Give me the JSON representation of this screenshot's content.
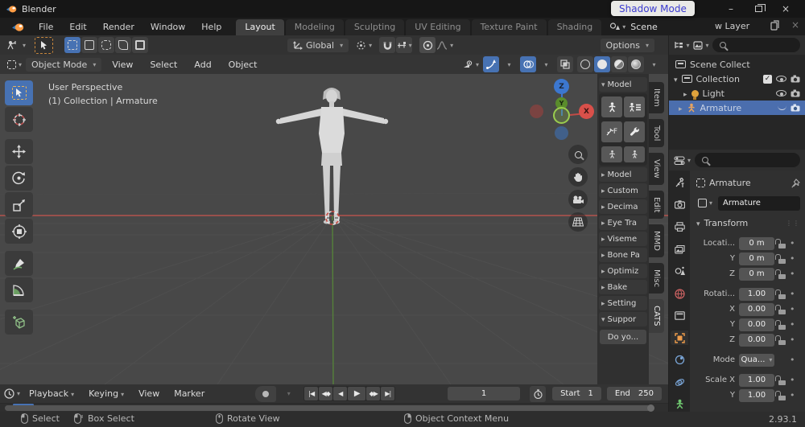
{
  "titlebar": {
    "app": "Blender"
  },
  "menubar": {
    "items": [
      "File",
      "Edit",
      "Render",
      "Window",
      "Help"
    ]
  },
  "workspaces": {
    "tabs": [
      "Layout",
      "Modeling",
      "Sculpting",
      "UV Editing",
      "Texture Paint",
      "Shading"
    ],
    "active": "Layout"
  },
  "scene_bar": {
    "scene": "Scene",
    "tooltip": "Shadow Mode",
    "view_layer_partial": "w Layer"
  },
  "tool_settings": {
    "orientation": "Global",
    "options": "Options"
  },
  "viewport_header": {
    "mode": "Object Mode",
    "menus": [
      "View",
      "Select",
      "Add",
      "Object"
    ]
  },
  "viewport": {
    "line1": "User Perspective",
    "line2": "(1) Collection | Armature",
    "axis": {
      "x": "X",
      "y": "Y",
      "z": "Z"
    }
  },
  "cats": {
    "model_panel": "Model",
    "fix_label": "F",
    "panels": [
      "Model",
      "Custom",
      "Decima",
      "Eye Tra",
      "Viseme",
      "Bone Pa",
      "Optimiz",
      "Bake",
      "Setting"
    ],
    "support_panel": "Suppor",
    "support_button": "Do yo..."
  },
  "side_tabs": [
    "Item",
    "Tool",
    "View",
    "Edit",
    "MMD",
    "Misc",
    "CATS"
  ],
  "outliner": {
    "scene": "Scene Collect",
    "collection": "Collection",
    "light": "Light",
    "armature": "Armature"
  },
  "properties": {
    "breadcrumb": "Armature",
    "object_name": "Armature",
    "panel": "Transform",
    "loc_label": "Locati...",
    "loc_x": "0 m",
    "y_label": "Y",
    "loc_y": "0 m",
    "z_label": "Z",
    "loc_z": "0 m",
    "rot_label": "Rotati...",
    "rot_w": "1.00",
    "x_label": "X",
    "rot_x": "0.00",
    "rot_y": "0.00",
    "rot_z": "0.00",
    "mode_label": "Mode",
    "mode_value": "Qua...",
    "scale_x_label": "Scale X",
    "scale_x": "1.00",
    "scale_y_label": "Y",
    "scale_y": "1.00"
  },
  "timeline": {
    "menus": [
      "Playback",
      "Keying",
      "View",
      "Marker"
    ],
    "transport": [
      "|◀",
      "◀◆",
      "◀",
      "▶",
      "◆▶",
      "▶|"
    ],
    "frame": "1",
    "start_label": "Start",
    "start_value": "1",
    "end_label": "End",
    "end_value": "250"
  },
  "statusbar": {
    "select": "Select",
    "box_select": "Box Select",
    "rotate_view": "Rotate View",
    "context_menu": "Object Context Menu",
    "version": "2.93.1"
  },
  "colors": {
    "accent_blue": "#4772b3",
    "blender_orange": "#e87d0d",
    "tooltip_text": "#3b3bd0",
    "selection_row": "#4b6eae"
  }
}
